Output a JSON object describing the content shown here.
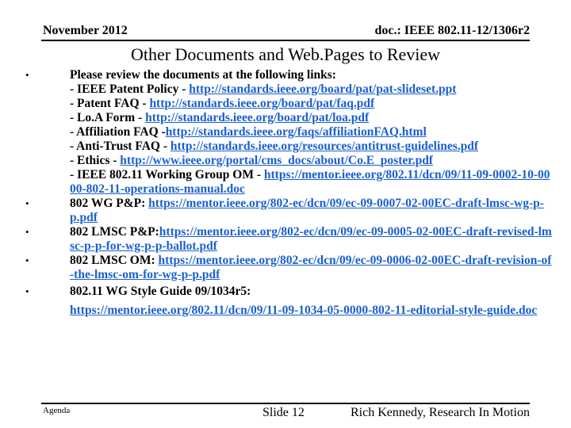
{
  "header": {
    "date": "November 2012",
    "doc": "doc.: IEEE 802.11-12/1306r2"
  },
  "title": "Other Documents and Web.Pages to Review",
  "bullets": [
    {
      "intro": "Please review the documents at the following links:",
      "subitems": [
        {
          "label": "- IEEE Patent Policy - ",
          "link": "http://standards.ieee.org/board/pat/pat-slideset.ppt"
        },
        {
          "label": "- Patent FAQ - ",
          "link": "http://standards.ieee.org/board/pat/faq.pdf"
        },
        {
          "label": "- Lo.A Form - ",
          "link": "http://standards.ieee.org/board/pat/loa.pdf"
        },
        {
          "label": "- Affiliation FAQ -",
          "link": "http://standards.ieee.org/faqs/affiliationFAQ.html"
        },
        {
          "label": "- Anti-Trust FAQ - ",
          "link": "http://standards.ieee.org/resources/antitrust-guidelines.pdf"
        },
        {
          "label": "- Ethics - ",
          "link": "http://www.ieee.org/portal/cms_docs/about/Co.E_poster.pdf"
        },
        {
          "label": "- IEEE 802.11 Working Group OM - ",
          "link": "https://mentor.ieee.org/802.11/dcn/09/11-09-0002-10-0000-802-11-operations-manual.doc"
        }
      ]
    },
    {
      "label": "802 WG P&P: ",
      "link": "https://mentor.ieee.org/802-ec/dcn/09/ec-09-0007-02-00EC-draft-lmsc-wg-p-p.pdf"
    },
    {
      "label": "802 LMSC P&P:",
      "link": "https://mentor.ieee.org/802-ec/dcn/09/ec-09-0005-02-00EC-draft-revised-lmsc-p-p-for-wg-p-p-ballot.pdf"
    },
    {
      "label": "802 LMSC OM: ",
      "link": "https://mentor.ieee.org/802-ec/dcn/09/ec-09-0006-02-00EC-draft-revision-of-the-lmsc-om-for-wg-p-p.pdf"
    },
    {
      "label": "802.11 WG Style Guide  09/1034r5: ",
      "link": "https://mentor.ieee.org/802.11/dcn/09/11-09-1034-05-0000-802-11-editorial-style-guide.doc"
    }
  ],
  "bullet_glyph": "•",
  "footer": {
    "left": "Agenda",
    "slide": "Slide 12",
    "author": "Rich Kennedy, Research In Motion"
  },
  "colors": {
    "link": "#1a5fcf",
    "text": "#000000",
    "background": "#ffffff"
  }
}
